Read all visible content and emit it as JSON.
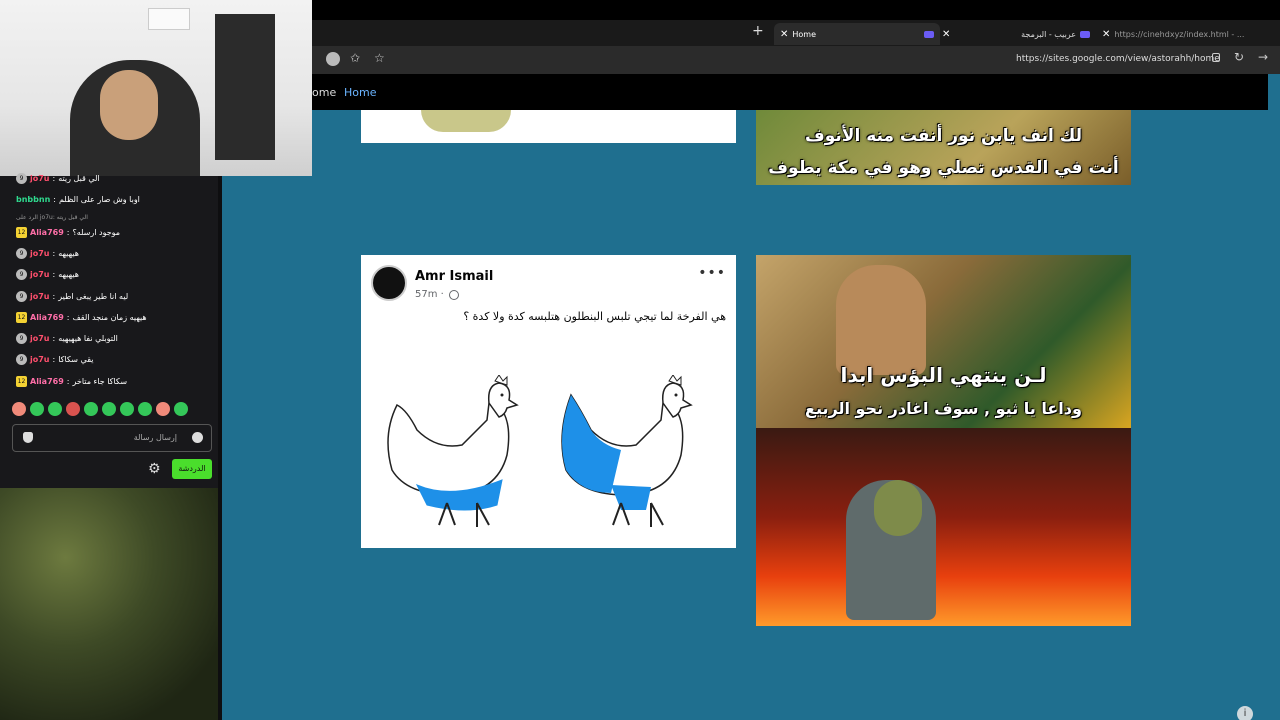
{
  "browser": {
    "tabs": [
      {
        "label": "Home",
        "active": true
      },
      {
        "label": "عربيب - البرمجة",
        "active": false
      },
      {
        "label": "https://cinehdxyz/index.html - ...",
        "active": false
      }
    ],
    "url": "https://sites.google.com/view/astorahh/home"
  },
  "site_nav": {
    "items": [
      "ome",
      "Home"
    ]
  },
  "chat": {
    "messages": [
      {
        "user": "jo7u",
        "text": "الي قبل ريته",
        "color": "red",
        "badge": "9"
      },
      {
        "user": "bnbbnn",
        "text": "اوبا وش صار على الظلم",
        "color": "green",
        "badge": ""
      },
      {
        "user": "Alia769",
        "text": "موجود ارسله؟",
        "color": "pink",
        "badge": "12"
      },
      {
        "user": "jo7u",
        "text": "هيهيهه",
        "color": "red",
        "badge": "9"
      },
      {
        "user": "jo7u",
        "text": "هيهيهه",
        "color": "red",
        "badge": "9"
      },
      {
        "user": "jo7u",
        "text": "ليه انا طير يبغى اطير",
        "color": "red",
        "badge": "9"
      },
      {
        "user": "Alia769",
        "text": "هيهيه زمان منجد القف",
        "color": "pink",
        "badge": "12"
      },
      {
        "user": "jo7u",
        "text": "التوبلي نفا هيهيهيه",
        "color": "red",
        "badge": "9"
      },
      {
        "user": "jo7u",
        "text": "يقي سكاكا",
        "color": "red",
        "badge": "9"
      },
      {
        "user": "Alia769",
        "text": "سكاكا جاء متاخر",
        "color": "pink",
        "badge": "12"
      }
    ],
    "reply_hint": "الرد على jo7u: الي قبل ريته",
    "input_placeholder": "إرسال رسالة",
    "send_label": "الدردشة"
  },
  "posts": {
    "meme1_line1": "لك انف يابن نور أنفت منه الأنوف",
    "meme1_line2": "أنت في القدس تصلي وهو في مكة يطوف",
    "fb_author": "Amr Ismail",
    "fb_time": "57m ·",
    "fb_caption": "هي الفرخة لما تيجي تلبس البنطلون هتلبسه كدة ولا كدة ؟",
    "meme2_line1": "لـن ينتهي البؤس ابدا",
    "meme2_line2": "وداعا يا ثيو , سوف اغادر نحو الربيع"
  },
  "colors": {
    "page_bg": "#1f6f8f",
    "chick_blue": "#1e90e8"
  }
}
